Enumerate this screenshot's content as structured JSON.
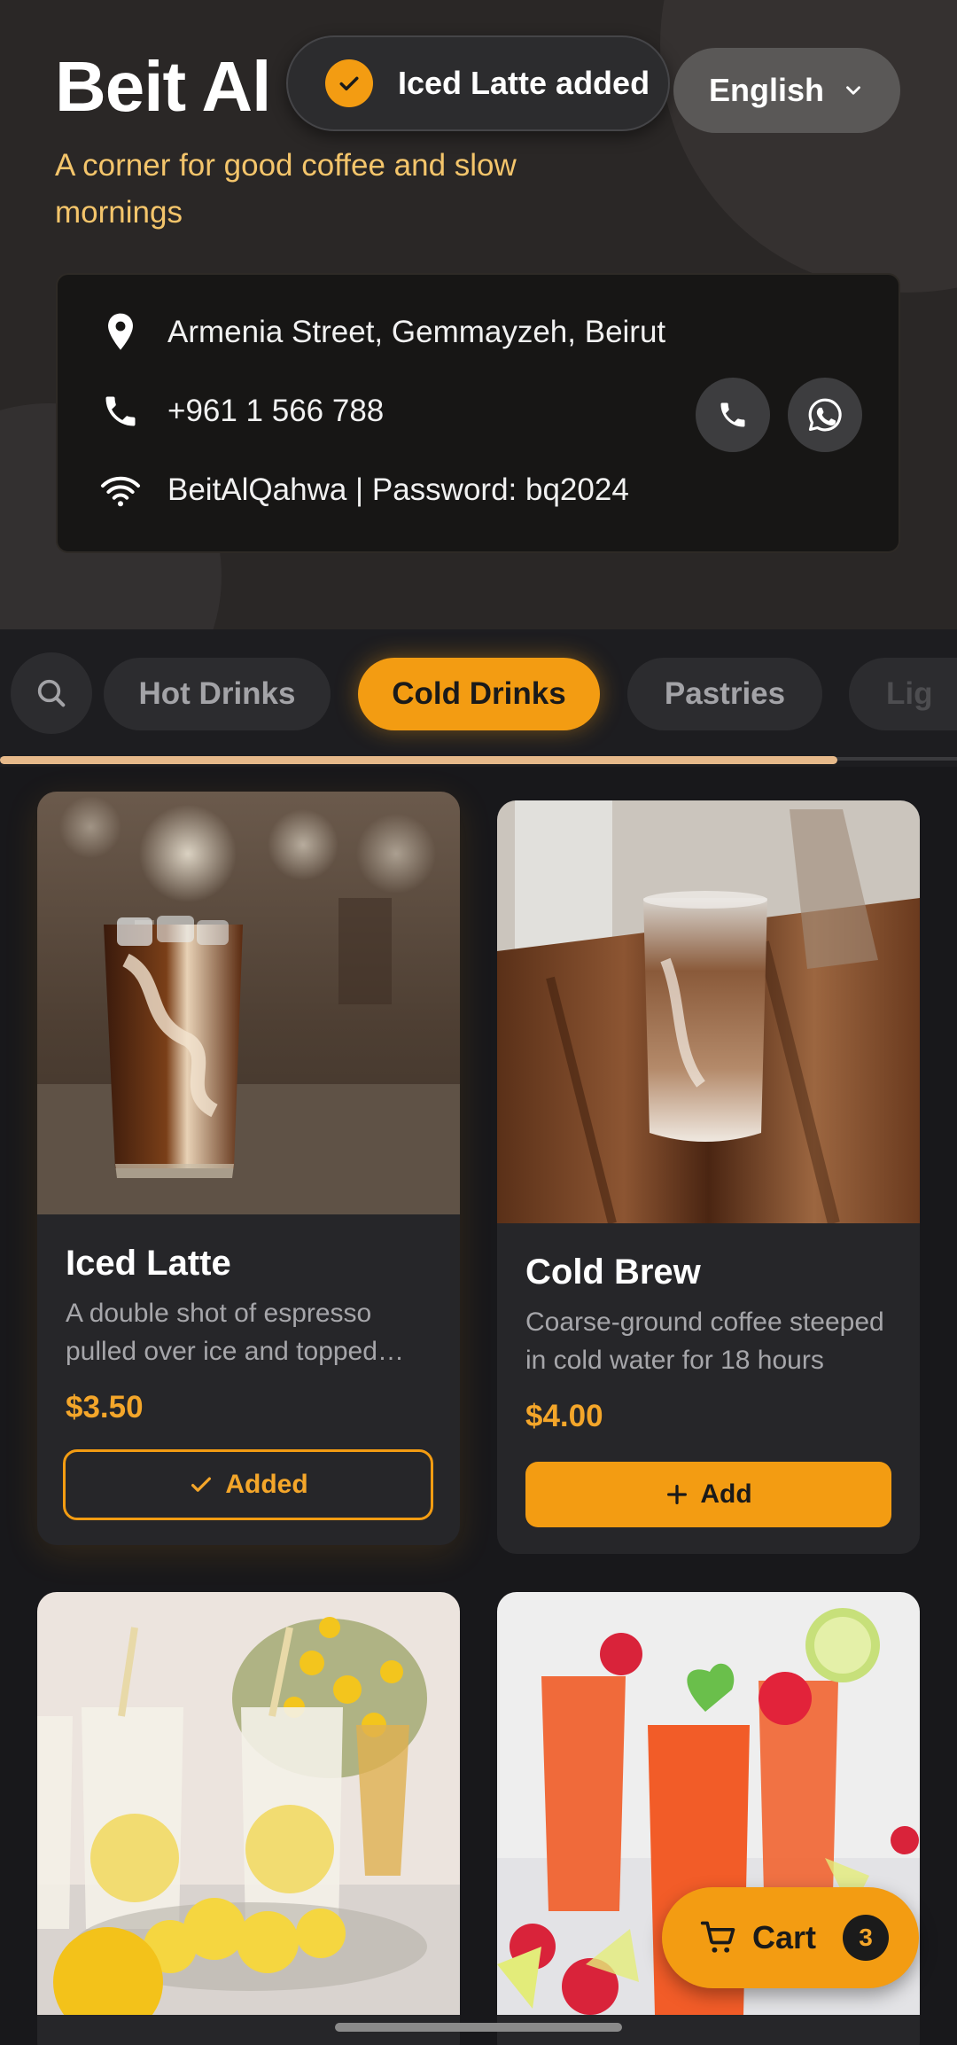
{
  "header": {
    "title": "Beit Al",
    "tagline": "A corner for good coffee and slow mornings"
  },
  "toast": {
    "text": "Iced Latte added",
    "icon": "check-icon"
  },
  "language": {
    "selected": "English",
    "icon": "chevron-down-icon"
  },
  "info": {
    "address": "Armenia Street, Gemmayzeh, Beirut",
    "phone": "+961 1 566 788",
    "wifi": "BeitAlQahwa | Password: bq2024"
  },
  "categories": {
    "items": [
      "Hot Drinks",
      "Cold Drinks",
      "Pastries",
      "Lig"
    ],
    "active": "Cold Drinks"
  },
  "products": [
    {
      "name": "Iced Latte",
      "description": "A double shot of espresso pulled over ice and topped with cold milk",
      "price": "$3.50",
      "button": "Added",
      "state": "added"
    },
    {
      "name": "Cold Brew",
      "description": "Coarse-ground coffee steeped in cold water for 18 hours",
      "price": "$4.00",
      "button": "Add",
      "state": "add"
    }
  ],
  "cart": {
    "label": "Cart",
    "count": "3"
  },
  "colors": {
    "accent": "#f39c12",
    "price": "#f4a62a",
    "tagline": "#f4c56b",
    "background": "#18181b",
    "card": "#262629"
  }
}
